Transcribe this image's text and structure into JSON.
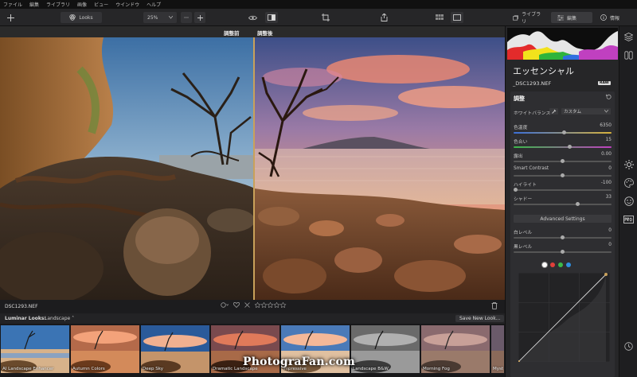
{
  "menu": [
    "ファイル",
    "編集",
    "ライブラリ",
    "画像",
    "ビュー",
    "ウインドウ",
    "ヘルプ"
  ],
  "toolbar": {
    "looks_label": "Looks",
    "zoom_value": "25%",
    "tab_library": "ライブラリ",
    "tab_edit": "編集",
    "tab_info": "情報"
  },
  "canvas": {
    "before_label": "調整前",
    "after_label": "調整後"
  },
  "info_row": {
    "filename": "DSC1293.NEF"
  },
  "looks_bar": {
    "label": "Luminar Looks:",
    "category": "Landscape",
    "save_label": "Save New Look..."
  },
  "thumbnails": [
    {
      "name": "AI Landscape Enhancer"
    },
    {
      "name": "Autumn Colors"
    },
    {
      "name": "Deep Sky"
    },
    {
      "name": "Dramatic Landscape"
    },
    {
      "name": "Impressive"
    },
    {
      "name": "Landscape B&W"
    },
    {
      "name": "Morning Fog"
    },
    {
      "name": "Myst"
    }
  ],
  "watermark": "PhotograFan.com",
  "panel": {
    "title": "エッセンシャル",
    "file": "_DSC1293.NEF",
    "raw": "RAW",
    "tool": "調整",
    "wb_label": "ホワイトバランス",
    "wb_value": "カスタム",
    "sliders": [
      {
        "label": "色温度",
        "value": "6350",
        "pos": 0.52
      },
      {
        "label": "色合い",
        "value": "15",
        "pos": 0.58
      },
      {
        "label": "露出",
        "value": "0.00",
        "pos": 0.5
      },
      {
        "label": "Smart Contrast",
        "value": "0",
        "pos": 0.5
      },
      {
        "label": "ハイライト",
        "value": "-100",
        "pos": 0.0
      },
      {
        "label": "シャドー",
        "value": "33",
        "pos": 0.66
      }
    ],
    "advanced": "Advanced Settings",
    "levels": [
      {
        "label": "白レベル",
        "value": "0",
        "pos": 0.5
      },
      {
        "label": "黒レベル",
        "value": "0",
        "pos": 0.5
      }
    ]
  },
  "colors": {
    "accent": "#c9a15a",
    "curve_white": "#ffffff",
    "curve_red": "#e0403a",
    "curve_green": "#3cba4a",
    "curve_blue": "#2f8fe0"
  }
}
